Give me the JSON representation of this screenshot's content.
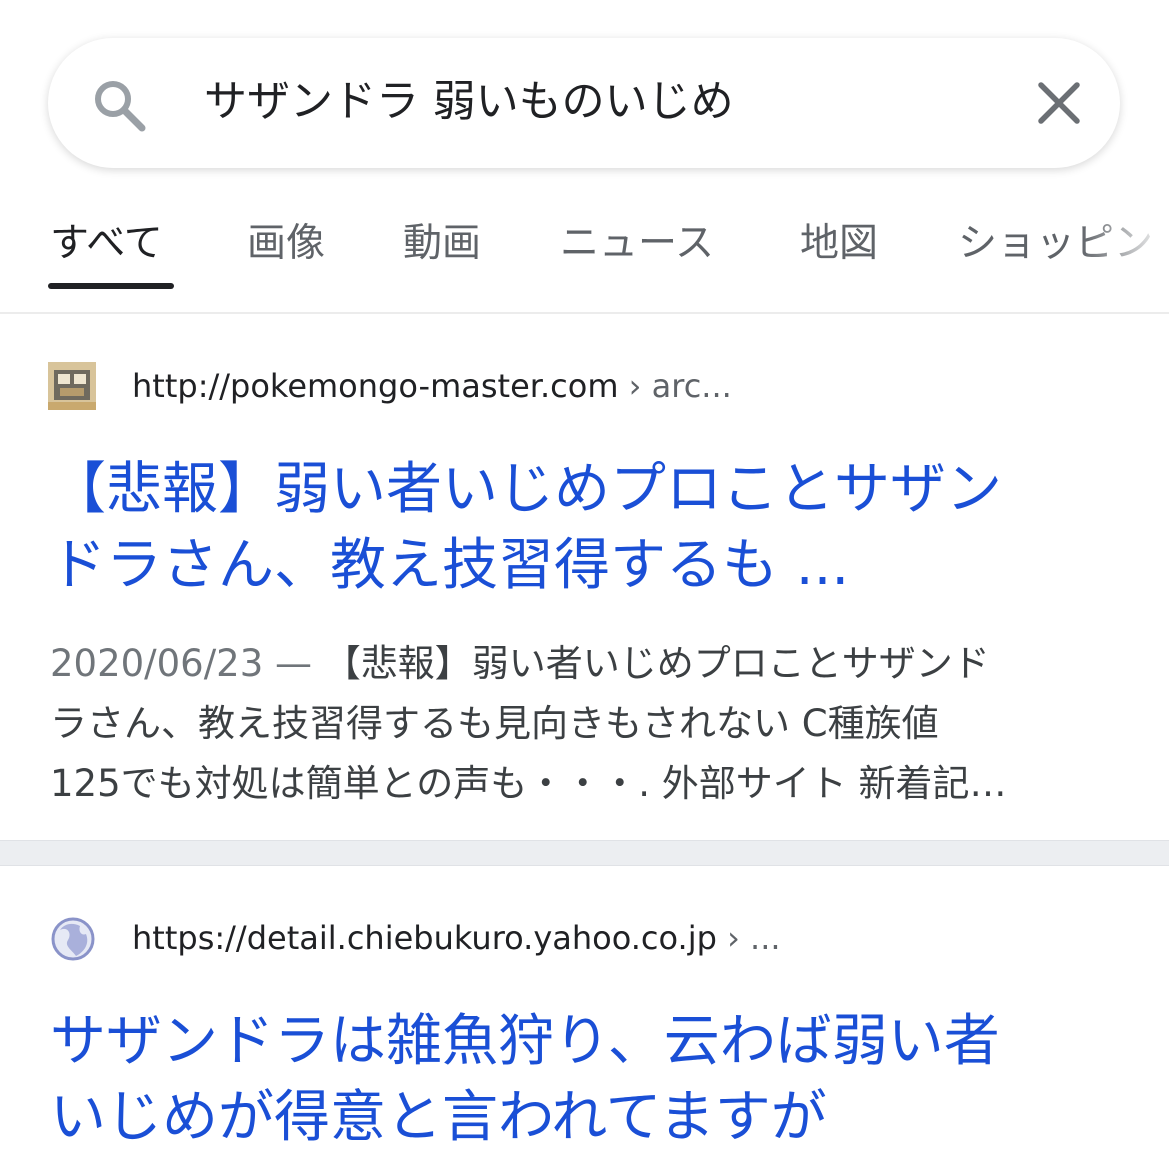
{
  "search": {
    "query": "サザンドラ 弱いものいじめ"
  },
  "tabs": [
    {
      "label": "すべて",
      "active": true
    },
    {
      "label": "画像",
      "active": false
    },
    {
      "label": "動画",
      "active": false
    },
    {
      "label": "ニュース",
      "active": false
    },
    {
      "label": "地図",
      "active": false
    },
    {
      "label": "ショッピン",
      "active": false
    }
  ],
  "results": [
    {
      "favicon": "site-thumbnail-icon",
      "url": "http://pokemongo-master.com",
      "breadcrumb": " › arc...",
      "title_lines": [
        "【悲報】弱い者いじめプロことサザン",
        "ドラさん、教え技習得するも ..."
      ],
      "date": "2020/06/23",
      "date_separator": " — ",
      "snippet_lines": [
        "【悲報】弱い者いじめプロことサザンド",
        "ラさん、教え技習得するも見向きもされない C種族値",
        "125でも対処は簡単との声も・・・. 外部サイト 新着記…"
      ]
    },
    {
      "favicon": "globe-icon",
      "url": "https://detail.chiebukuro.yahoo.co.jp",
      "breadcrumb": " › ...",
      "title_lines": [
        "サザンドラは雑魚狩り、云わば弱い者",
        "いじめが得意と言われてますが"
      ]
    }
  ],
  "colors": {
    "title_link": "#1a4fd6",
    "text": "#202124",
    "muted": "#5f6368",
    "separator": "#eceef1"
  }
}
